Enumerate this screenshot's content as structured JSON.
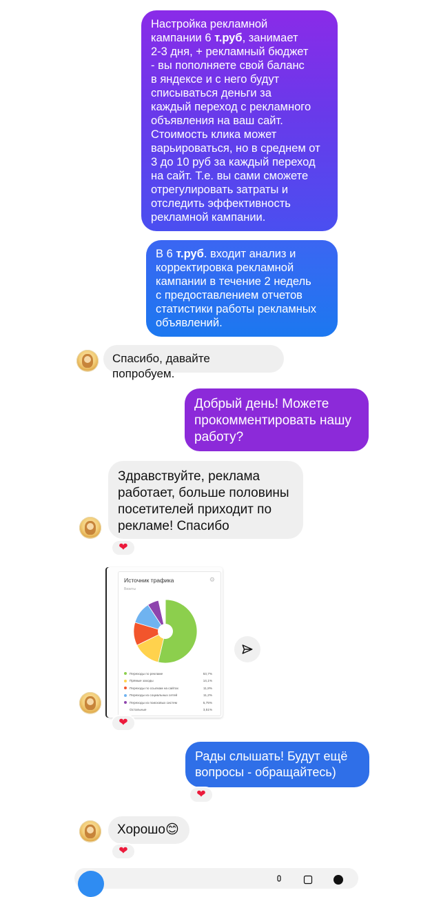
{
  "messages": [
    {
      "text": "Настройка рекламной\nкампании 6 т.руб, занимает\n2-3 дня, + рекламный бюджет\n- вы пополняете свой баланс\nв яндексе и с него будут\nсписываться деньги за\nкаждый переход с рекламного\nобъявления на ваш сайт.\nСтоимость клика может\nварьироваться, но в среднем от\n3 до 10 руб  за каждый переход\nна сайт. Т.е. вы сами сможете\nотрегулировать затраты и\nотследить эффективность\nрекламной кампании."
    },
    {
      "text": "В 6 т.руб. входит анализ и\nкорректировка  рекламной\nкампании в течение 2 недель\nс предоставлением отчетов\nстатистики работы рекламных\nобъявлений."
    },
    {
      "text": "Спасибо, давайте попробуем."
    },
    {
      "text": "Добрый день! Можете\nпрокомментировать нашу\nработу?"
    },
    {
      "text": "Здравствуйте, реклама\nработает, больше половины\nпосетителей приходит по\nрекламе! Спасибо"
    },
    {
      "text": "Рады слышать! Будут ещё\nвопросы - обращайтесь)"
    },
    {
      "text": "Хорошо😊"
    }
  ],
  "reaction": "❤",
  "attachment": {
    "title": "Источник трафика",
    "subtitle": "Визиты",
    "legend": [
      {
        "label": "Переходы по рекламе",
        "value": "53,7%",
        "color": "#8ccf4d"
      },
      {
        "label": "Прямые заходы",
        "value": "14,1%",
        "color": "#ffd24d"
      },
      {
        "label": "Переходы по ссылкам на сайтах",
        "value": "11,8%",
        "color": "#f2552c"
      },
      {
        "label": "Переходы из социальных сетей",
        "value": "11,2%",
        "color": "#6fb3f0"
      },
      {
        "label": "Переходы из поисковых систем",
        "value": "5,75%",
        "color": "#8e44ad"
      },
      {
        "label": "Остальные",
        "value": "3,51%",
        "color": "#ffffff"
      }
    ]
  },
  "chart_data": {
    "type": "pie",
    "title": "Источник трафика",
    "subtitle": "Визиты",
    "categories": [
      "Переходы по рекламе",
      "Прямые заходы",
      "Переходы по ссылкам на сайтах",
      "Переходы из социальных сетей",
      "Переходы из поисковых систем",
      "Остальные"
    ],
    "values": [
      53.7,
      14.1,
      11.8,
      11.2,
      5.75,
      3.51
    ],
    "colors": [
      "#8ccf4d",
      "#ffd24d",
      "#f2552c",
      "#6fb3f0",
      "#8e44ad",
      "#ffffff"
    ]
  },
  "icons": {
    "send": "send-icon",
    "heart": "heart-icon",
    "camera": "camera-icon"
  }
}
